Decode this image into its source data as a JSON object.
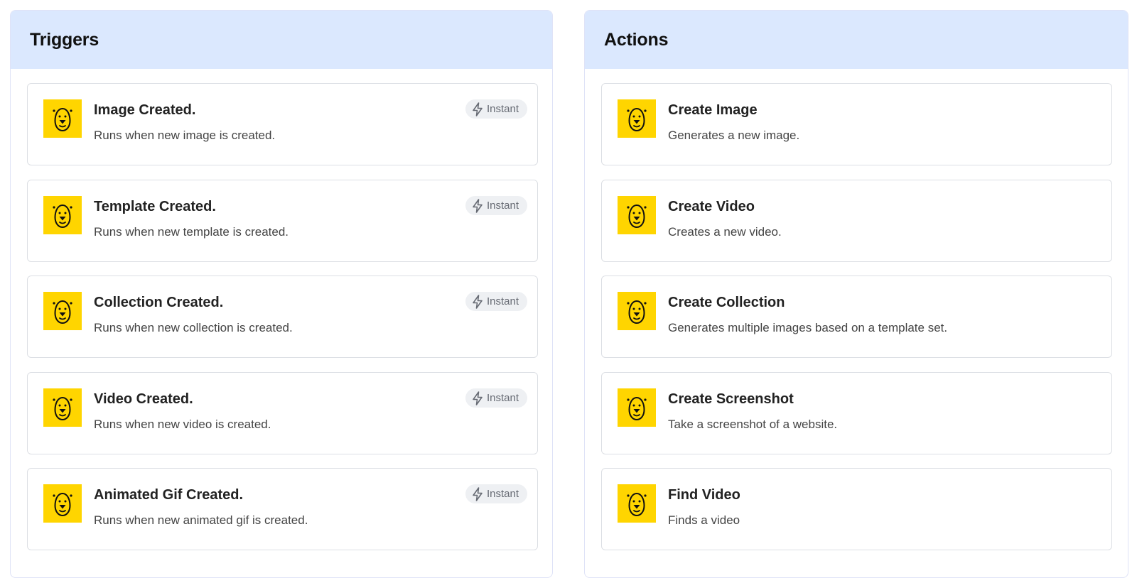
{
  "triggers": {
    "title": "Triggers",
    "items": [
      {
        "title": "Image Created.",
        "description": "Runs when new image is created.",
        "badge": "Instant",
        "icon": "bear-logo-icon"
      },
      {
        "title": "Template Created.",
        "description": "Runs when new template is created.",
        "badge": "Instant",
        "icon": "bear-logo-icon"
      },
      {
        "title": "Collection Created.",
        "description": "Runs when new collection is created.",
        "badge": "Instant",
        "icon": "bear-logo-icon"
      },
      {
        "title": "Video Created.",
        "description": "Runs when new video is created.",
        "badge": "Instant",
        "icon": "bear-logo-icon"
      },
      {
        "title": "Animated Gif Created.",
        "description": "Runs when new animated gif is created.",
        "badge": "Instant",
        "icon": "bear-logo-icon"
      }
    ]
  },
  "actions": {
    "title": "Actions",
    "items": [
      {
        "title": "Create Image",
        "description": "Generates a new image.",
        "icon": "bear-logo-icon"
      },
      {
        "title": "Create Video",
        "description": "Creates a new video.",
        "icon": "bear-logo-icon"
      },
      {
        "title": "Create Collection",
        "description": "Generates multiple images based on a template set.",
        "icon": "bear-logo-icon"
      },
      {
        "title": "Create Screenshot",
        "description": "Take a screenshot of a website.",
        "icon": "bear-logo-icon"
      },
      {
        "title": "Find Video",
        "description": "Finds a video",
        "icon": "bear-logo-icon"
      }
    ]
  },
  "colors": {
    "header_bg": "#dbe8fe",
    "icon_bg": "#ffd500",
    "badge_bg": "#eef0f3"
  }
}
